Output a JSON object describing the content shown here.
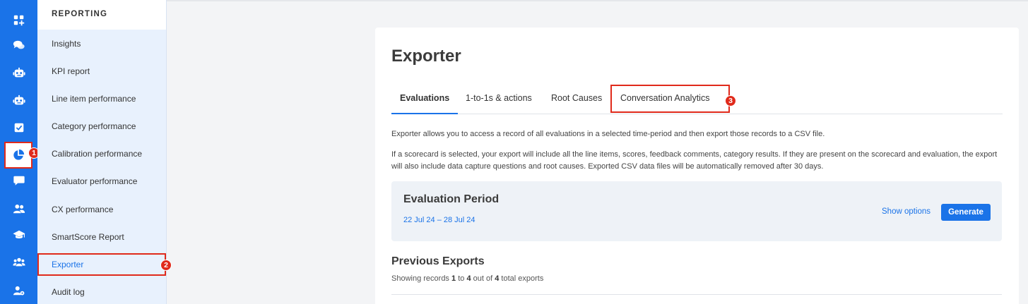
{
  "rail": {
    "items": [
      {
        "icon": "dashboard-add-icon"
      },
      {
        "icon": "chat-bubbles-icon"
      },
      {
        "icon": "robot-icon"
      },
      {
        "icon": "robot-icon"
      },
      {
        "icon": "checkbox-icon"
      },
      {
        "icon": "pie-chart-icon",
        "active": true
      },
      {
        "icon": "message-icon"
      },
      {
        "icon": "users-icon"
      },
      {
        "icon": "graduation-cap-icon"
      },
      {
        "icon": "team-icon"
      },
      {
        "icon": "user-settings-icon"
      }
    ]
  },
  "nav": {
    "header": "REPORTING",
    "items": [
      {
        "label": "Insights"
      },
      {
        "label": "KPI report"
      },
      {
        "label": "Line item performance"
      },
      {
        "label": "Category performance"
      },
      {
        "label": "Calibration performance"
      },
      {
        "label": "Evaluator performance"
      },
      {
        "label": "CX performance"
      },
      {
        "label": "SmartScore Report"
      },
      {
        "label": "Exporter",
        "active": true
      },
      {
        "label": "Audit log"
      }
    ]
  },
  "annotations": {
    "badge1": "1",
    "badge2": "2",
    "badge3": "3"
  },
  "page": {
    "title": "Exporter",
    "tabs": [
      {
        "label": "Evaluations",
        "active": true
      },
      {
        "label": "1-to-1s & actions"
      },
      {
        "label": "Root Causes"
      },
      {
        "label": "Conversation Analytics"
      }
    ],
    "intro": "Exporter allows you to access a record of all evaluations in a selected time-period and then export those records to a CSV file.",
    "details": "If a scorecard is selected, your export will include all the line items, scores, feedback comments, category results. If they are present on the scorecard and evaluation, the export will also include data capture questions and root causes. Exported CSV data files will be automatically removed after 30 days.",
    "period": {
      "title": "Evaluation Period",
      "range": "22 Jul 24 – 28 Jul 24",
      "show_options": "Show options",
      "generate": "Generate"
    },
    "previous": {
      "title": "Previous Exports",
      "prefix": "Showing records",
      "from": "1",
      "to_word": "to",
      "to": "4",
      "out_of": "out of",
      "total": "4",
      "suffix": "total exports"
    }
  },
  "colors": {
    "accent": "#1a73e8",
    "annotation": "#e02a1b"
  }
}
